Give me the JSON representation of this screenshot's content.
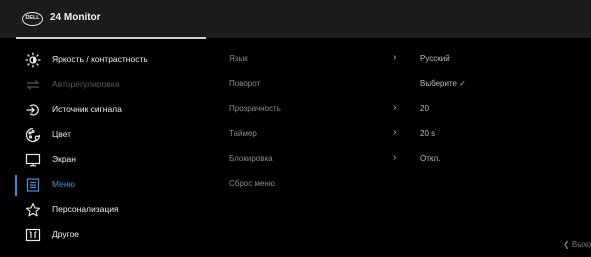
{
  "header": {
    "logo_text": "DELL",
    "title": "24 Monitor"
  },
  "menu": {
    "items": [
      {
        "label": "Яркость / контрастность",
        "icon": "brightness-icon"
      },
      {
        "label": "Авторегулировка",
        "icon": "auto-adjust-icon",
        "disabled": true
      },
      {
        "label": "Источник сигнала",
        "icon": "input-source-icon"
      },
      {
        "label": "Цвет",
        "icon": "color-icon"
      },
      {
        "label": "Экран",
        "icon": "display-icon"
      },
      {
        "label": "Меню",
        "icon": "menu-icon",
        "active": true
      },
      {
        "label": "Персонализация",
        "icon": "star-icon"
      },
      {
        "label": "Другое",
        "icon": "others-icon"
      }
    ]
  },
  "submenu": {
    "items": [
      {
        "label": "Язык",
        "chevron": "›",
        "value": "Русский"
      },
      {
        "label": "Поворот",
        "chevron": "",
        "value": "Выберите ✓"
      },
      {
        "label": "Прозрачность",
        "chevron": "›",
        "value": "20"
      },
      {
        "label": "Таймер",
        "chevron": "›",
        "value": "20 s"
      },
      {
        "label": "Блокировка",
        "chevron": "›",
        "value": "Откл."
      },
      {
        "label": "Сброс меню",
        "chevron": "",
        "value": ""
      }
    ]
  },
  "footer": {
    "exit_label": "❮ Выход"
  },
  "colors": {
    "accent": "#2f8fe8",
    "background": "#000000",
    "header": "#1b1b1b"
  }
}
